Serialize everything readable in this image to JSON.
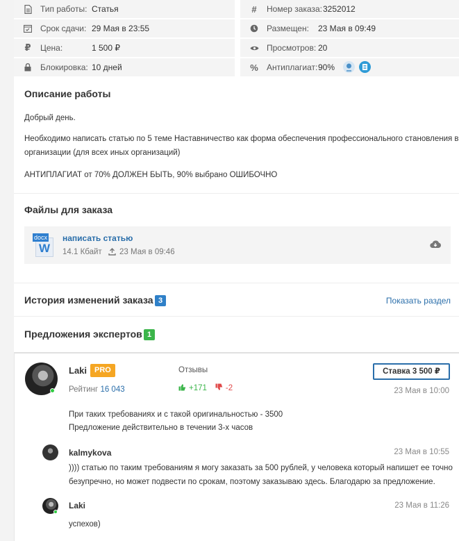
{
  "attributes_left": [
    {
      "icon": "document-icon",
      "label": "Тип работы:",
      "value": "Статья"
    },
    {
      "icon": "calendar-icon",
      "label": "Срок сдачи:",
      "value": "29 Мая в 23:55"
    },
    {
      "icon": "ruble-icon",
      "label": "Цена:",
      "value": "1 500 ₽"
    },
    {
      "icon": "lock-icon",
      "label": "Блокировка:",
      "value": "10 дней"
    }
  ],
  "attributes_right": [
    {
      "icon": "hash-icon",
      "label": "Номер заказа:",
      "value": "3252012"
    },
    {
      "icon": "clock-icon",
      "label": "Размещен:",
      "value": "23 Мая в 09:49"
    },
    {
      "icon": "eye-icon",
      "label": "Просмотров:",
      "value": "20"
    },
    {
      "icon": "percent-icon",
      "label": "Антиплагиат:",
      "value": "90%"
    }
  ],
  "description": {
    "title": "Описание работы",
    "p1": "Добрый день.",
    "p2a": "Необходимо написать статью по 5 теме Наставничество как форма обеспечения профессионального становления в",
    "p2b": "организации (для всех иных организаций)",
    "p3": "АНТИПЛАГИАТ от 70% ДОЛЖЕН БЫТЬ, 90% выбрано ОШИБОЧНО"
  },
  "files": {
    "title": "Файлы для заказа",
    "file_ext": "docx",
    "file_letter": "W",
    "file_name": "написать статью",
    "file_size": "14.1 Кбайт",
    "file_date": "23 Мая в 09:46"
  },
  "history": {
    "title": "История изменений заказа",
    "count": "3",
    "show_link": "Показать раздел"
  },
  "offers": {
    "title": "Предложения экспертов",
    "count": "1",
    "expert_name": "Laki",
    "pro_badge": "PRO",
    "rating_label": "Рейтинг",
    "rating_value": "16 043",
    "reviews_label": "Отзывы",
    "reviews_positive": "+171",
    "reviews_negative": "-2",
    "bid_button": "Ставка 3 500 ₽",
    "date": "23 Мая в 10:00",
    "message_line1": "При таких требованиях и с такой оригинальностью - 3500",
    "message_line2": "Предложение действительно в течении 3-х часов"
  },
  "comments": [
    {
      "author": "kalmykova",
      "date": "23 Мая в 10:55",
      "line1": ")))) статью по таким требованиям я могу заказать за 500 рублей, у человека который напишет ее точно",
      "line2": "безупречно, но может подвести по срокам, поэтому заказываю здесь. Благодарю за предложение."
    },
    {
      "author": "Laki",
      "date": "23 Мая в 11:26",
      "line1": "успехов)"
    }
  ],
  "colors": {
    "accent_blue": "#2a6eaa",
    "badge_blue": "#2f80c8",
    "badge_green": "#3bb54a",
    "pro_orange": "#f5a623",
    "positive": "#3bb54a",
    "negative": "#e04848"
  }
}
